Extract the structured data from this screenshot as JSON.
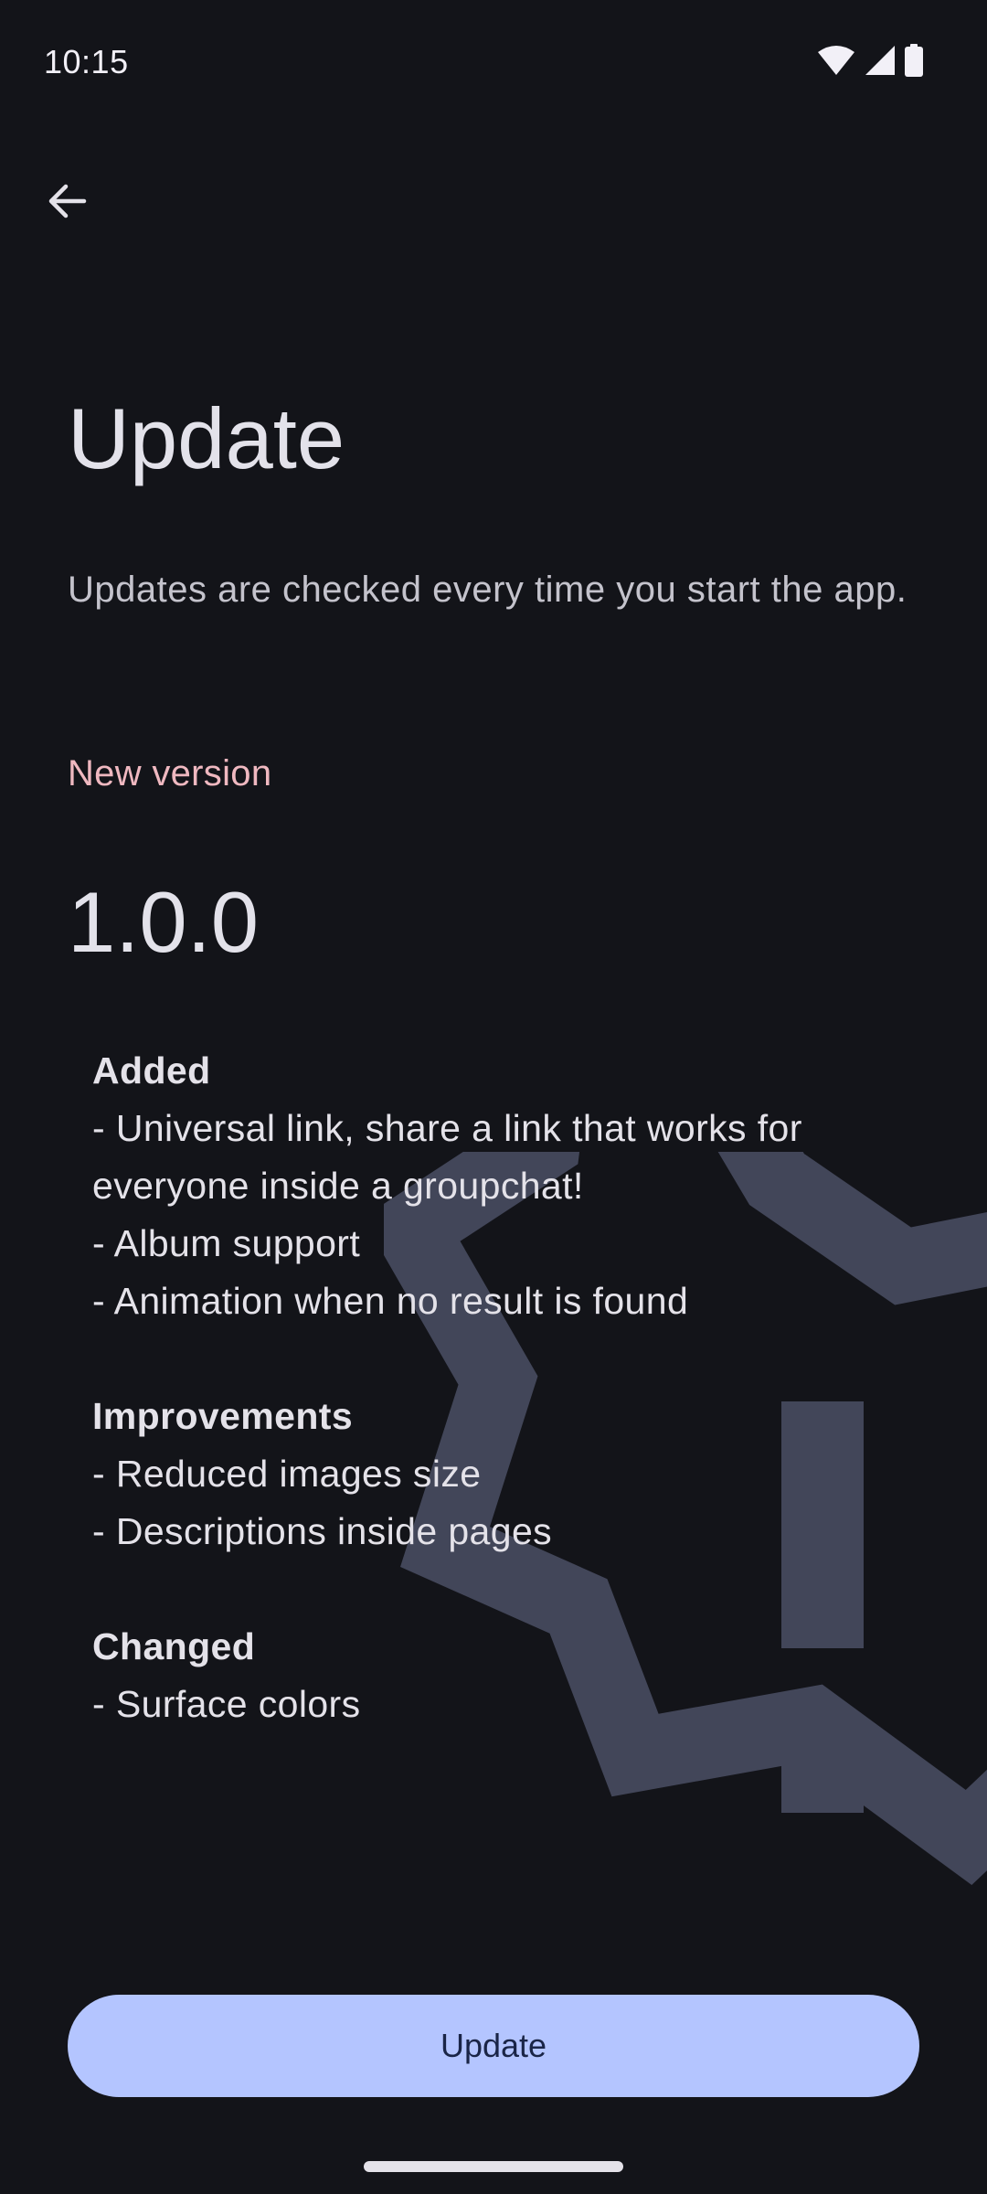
{
  "status_bar": {
    "time": "10:15",
    "icons": [
      "wifi-icon",
      "signal-icon",
      "battery-icon"
    ]
  },
  "header": {
    "back_icon": "arrow-left-icon"
  },
  "page": {
    "title": "Update",
    "description": "Updates are checked every time you start the app.",
    "section_label": "New version",
    "version": "1.0.0"
  },
  "changelog": [
    {
      "heading": "Added",
      "items": [
        "- Universal link, share a link that works for everyone inside a groupchat!",
        "- Album support",
        "- Animation when no result is found"
      ]
    },
    {
      "heading": "Improvements",
      "items": [
        "- Reduced images size",
        "- Descriptions inside pages"
      ]
    },
    {
      "heading": "Changed",
      "items": [
        "- Surface colors"
      ]
    }
  ],
  "actions": {
    "update_label": "Update"
  },
  "colors": {
    "background": "#131419",
    "accent_label": "#efb8c0",
    "button_bg": "#b4c5ff",
    "badge_art": "#424659"
  }
}
